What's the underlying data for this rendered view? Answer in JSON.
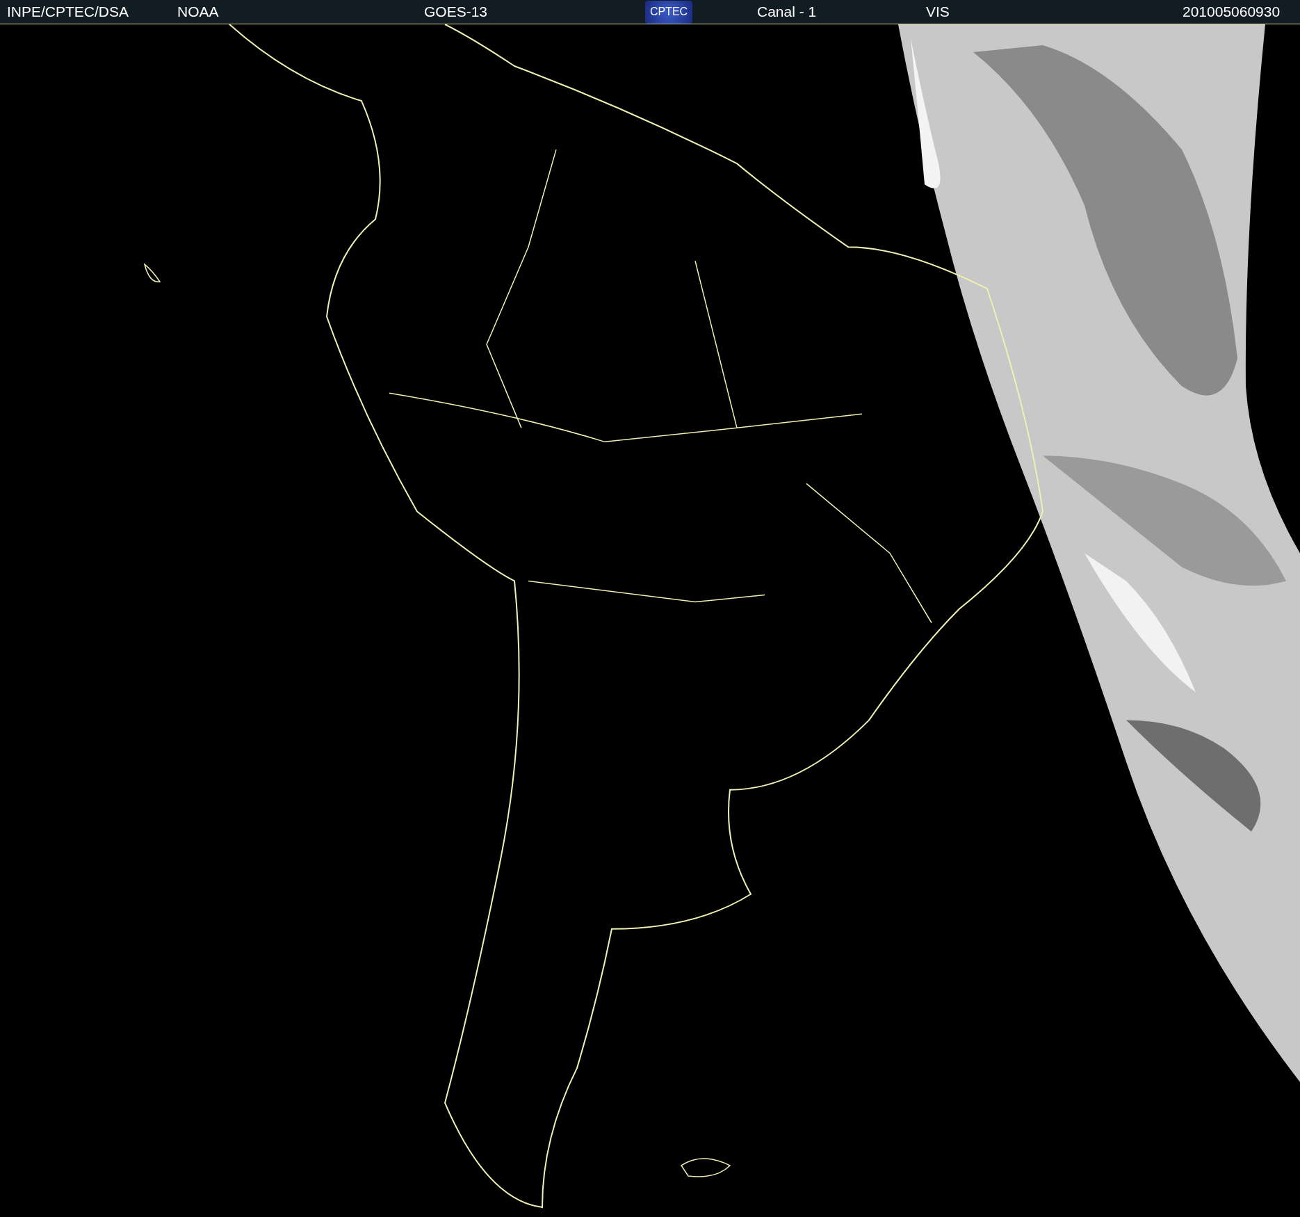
{
  "header": {
    "labels": [
      {
        "text": "INPE/CPTEC/DSA"
      },
      {
        "text": "NOAA"
      },
      {
        "text": "GOES-13"
      }
    ],
    "logo": {
      "text": "CPTEC"
    },
    "right_labels": [
      {
        "text": "Canal - 1"
      },
      {
        "text": "VIS"
      },
      {
        "text": "201005060930"
      }
    ]
  }
}
